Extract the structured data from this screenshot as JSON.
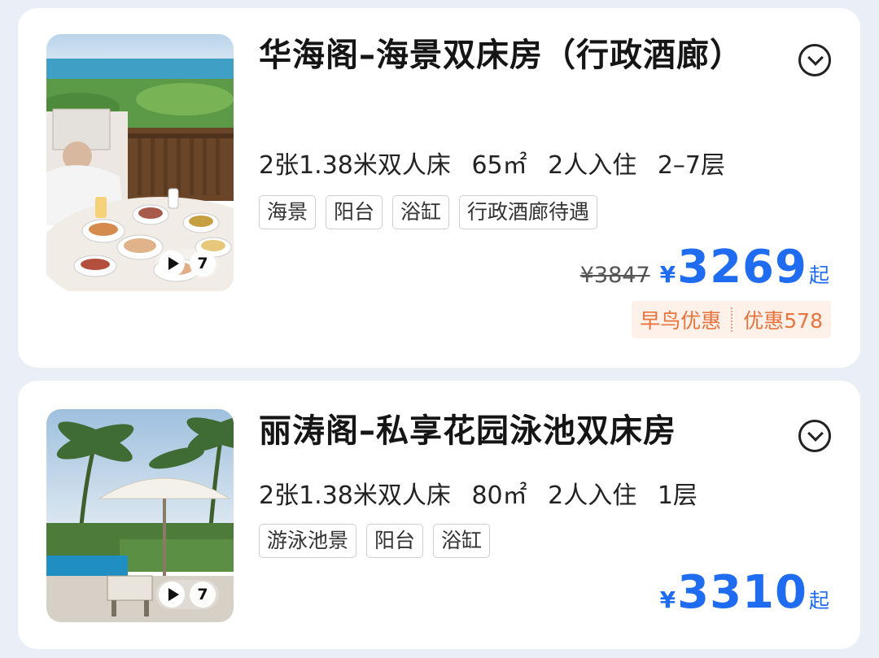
{
  "rooms": [
    {
      "title": "华海阁–海景双床房（行政酒廊）",
      "specs": [
        "2张1.38米双人床",
        "65㎡",
        "2人入住",
        "2–7层"
      ],
      "tags": [
        "海景",
        "阳台",
        "浴缸",
        "行政酒廊待遇"
      ],
      "video_count": "7",
      "original_price": "¥3847",
      "currency": "¥",
      "price": "3269",
      "price_suffix": "起",
      "promo": {
        "label": "早鸟优惠",
        "discount": "优惠578"
      }
    },
    {
      "title": "丽涛阁–私享花园泳池双床房",
      "specs": [
        "2张1.38米双人床",
        "80㎡",
        "2人入住",
        "1层"
      ],
      "tags": [
        "游泳池景",
        "阳台",
        "浴缸"
      ],
      "video_count": "7",
      "currency": "¥",
      "price": "3310",
      "price_suffix": "起"
    }
  ],
  "colors": {
    "price_blue": "#1f6cf0",
    "promo_orange": "#e8743d",
    "background": "#e9eef7"
  },
  "icons": [
    "play-icon",
    "chevron-down-icon"
  ]
}
